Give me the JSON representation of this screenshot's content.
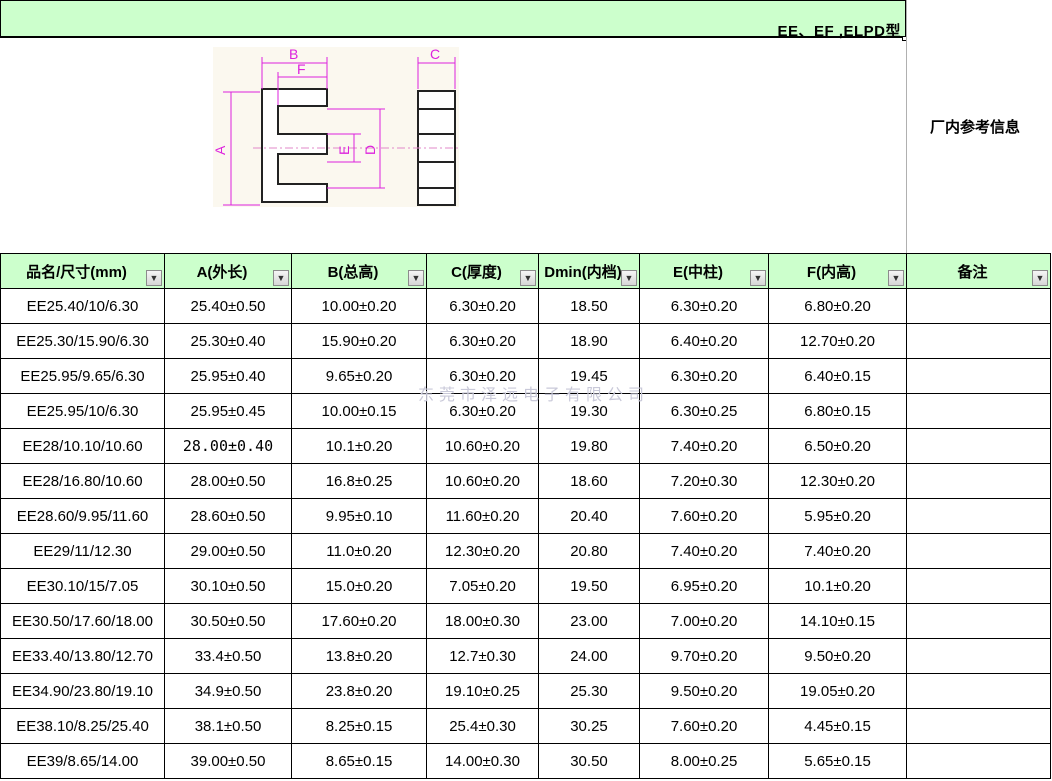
{
  "header": {
    "title": "EE、EF ,ELPD型",
    "side_info": "厂内参考信息"
  },
  "diagram": {
    "labels": {
      "a": "A",
      "b": "B",
      "c": "C",
      "d": "D",
      "e": "E",
      "f": "F"
    }
  },
  "table": {
    "columns": [
      "品名/尺寸(mm)",
      "A(外长)",
      "B(总高)",
      "C(厚度)",
      "Dmin(内档)",
      "E(中柱)",
      "F(内高)",
      "备注"
    ],
    "rows": [
      [
        "EE25.40/10/6.30",
        "25.40±0.50",
        "10.00±0.20",
        "6.30±0.20",
        "18.50",
        "6.30±0.20",
        "6.80±0.20",
        ""
      ],
      [
        "EE25.30/15.90/6.30",
        "25.30±0.40",
        "15.90±0.20",
        "6.30±0.20",
        "18.90",
        "6.40±0.20",
        "12.70±0.20",
        ""
      ],
      [
        "EE25.95/9.65/6.30",
        "25.95±0.40",
        "9.65±0.20",
        "6.30±0.20",
        "19.45",
        "6.30±0.20",
        "6.40±0.15",
        ""
      ],
      [
        "EE25.95/10/6.30",
        "25.95±0.45",
        "10.00±0.15",
        "6.30±0.20",
        "19.30",
        "6.30±0.25",
        "6.80±0.15",
        ""
      ],
      [
        "EE28/10.10/10.60",
        "28.00±0.40",
        "10.1±0.20",
        "10.60±0.20",
        "19.80",
        "7.40±0.20",
        "6.50±0.20",
        ""
      ],
      [
        "EE28/16.80/10.60",
        "28.00±0.50",
        "16.8±0.25",
        "10.60±0.20",
        "18.60",
        "7.20±0.30",
        "12.30±0.20",
        ""
      ],
      [
        "EE28.60/9.95/11.60",
        "28.60±0.50",
        "9.95±0.10",
        "11.60±0.20",
        "20.40",
        "7.60±0.20",
        "5.95±0.20",
        ""
      ],
      [
        "EE29/11/12.30",
        "29.00±0.50",
        "11.0±0.20",
        "12.30±0.20",
        "20.80",
        "7.40±0.20",
        "7.40±0.20",
        ""
      ],
      [
        "EE30.10/15/7.05",
        "30.10±0.50",
        "15.0±0.20",
        "7.05±0.20",
        "19.50",
        "6.95±0.20",
        "10.1±0.20",
        ""
      ],
      [
        "EE30.50/17.60/18.00",
        "30.50±0.50",
        "17.60±0.20",
        "18.00±0.30",
        "23.00",
        "7.00±0.20",
        "14.10±0.15",
        ""
      ],
      [
        "EE33.40/13.80/12.70",
        "33.4±0.50",
        "13.8±0.20",
        "12.7±0.30",
        "24.00",
        "9.70±0.20",
        "9.50±0.20",
        ""
      ],
      [
        "EE34.90/23.80/19.10",
        "34.9±0.50",
        "23.8±0.20",
        "19.10±0.25",
        "25.30",
        "9.50±0.20",
        "19.05±0.20",
        ""
      ],
      [
        "EE38.10/8.25/25.40",
        "38.1±0.50",
        "8.25±0.15",
        "25.4±0.30",
        "30.25",
        "7.60±0.20",
        "4.45±0.15",
        ""
      ],
      [
        "EE39/8.65/14.00",
        "39.00±0.50",
        "8.65±0.15",
        "14.00±0.30",
        "30.50",
        "8.00±0.25",
        "5.65±0.15",
        ""
      ]
    ]
  },
  "watermark": "东莞市泽远电子有限公司",
  "filter_icon": "filter-dropdown-icon"
}
